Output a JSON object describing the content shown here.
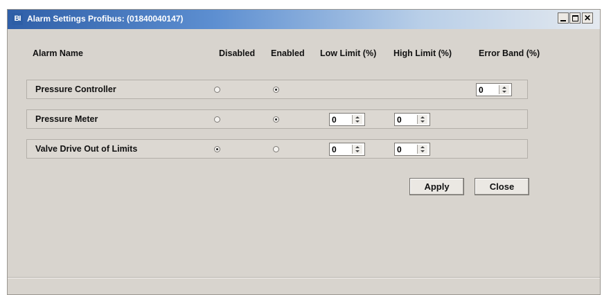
{
  "window": {
    "app_icon_text": "BI",
    "title": "Alarm Settings Profibus: (01840040147)"
  },
  "headers": {
    "alarm_name": "Alarm Name",
    "disabled": "Disabled",
    "enabled": "Enabled",
    "low_limit": "Low Limit (%)",
    "high_limit": "High Limit (%)",
    "error_band": "Error Band (%)"
  },
  "alarms": [
    {
      "name": "Pressure Controller",
      "state": "enabled",
      "error_band": "0"
    },
    {
      "name": "Pressure Meter",
      "state": "enabled",
      "low_limit": "0",
      "high_limit": "0"
    },
    {
      "name": "Valve Drive Out of Limits",
      "state": "disabled",
      "low_limit": "0",
      "high_limit": "0"
    }
  ],
  "buttons": {
    "apply": "Apply",
    "close": "Close"
  }
}
